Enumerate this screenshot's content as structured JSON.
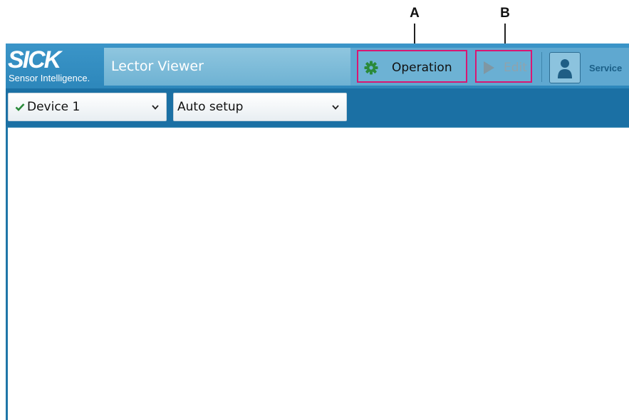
{
  "callouts": [
    {
      "label": "A",
      "target": "operation-button"
    },
    {
      "label": "B",
      "target": "edit-button"
    }
  ],
  "header": {
    "logo_word": "SICK",
    "logo_tagline": "Sensor Intelligence.",
    "app_title": "Lector Viewer",
    "operation_label": "Operation",
    "operation_icon": "gear-icon",
    "edit_label": "Edit",
    "edit_icon": "play-icon",
    "user_icon": "user-icon",
    "user_role": "Service"
  },
  "toolbar": {
    "device_select": {
      "value": "Device 1",
      "status_icon": "check-icon"
    },
    "mode_select": {
      "value": "Auto setup"
    }
  },
  "colors": {
    "highlight": "#d91672",
    "header_blue": "#2d87bb",
    "status_green": "#2a8a3a"
  }
}
